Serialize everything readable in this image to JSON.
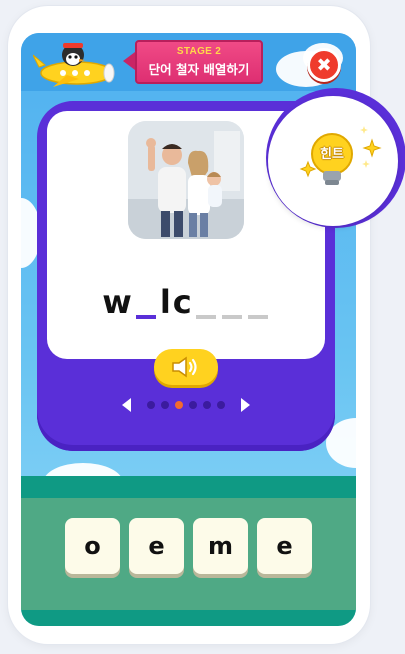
{
  "stage": {
    "label": "STAGE 2",
    "title": "단어 철자 배열하기"
  },
  "close_button": {
    "glyph": "✖"
  },
  "hint_button": {
    "label": "힌트"
  },
  "word_puzzle": {
    "letters": [
      "w",
      "",
      "l",
      "c",
      "",
      "",
      ""
    ],
    "active_slot": 1
  },
  "speaker_icon": "speaker-icon",
  "pager": {
    "total": 6,
    "current": 3
  },
  "letter_tiles": [
    "o",
    "e",
    "m",
    "e"
  ],
  "colors": {
    "sky": "#4fb0f0",
    "card_frame": "#5a2fd8",
    "stage_banner": "#de2f72",
    "close": "#ef3b2c",
    "tray": "#4fa985",
    "speaker_button": "#ffd21f",
    "active_dot": "#f36a2f"
  }
}
